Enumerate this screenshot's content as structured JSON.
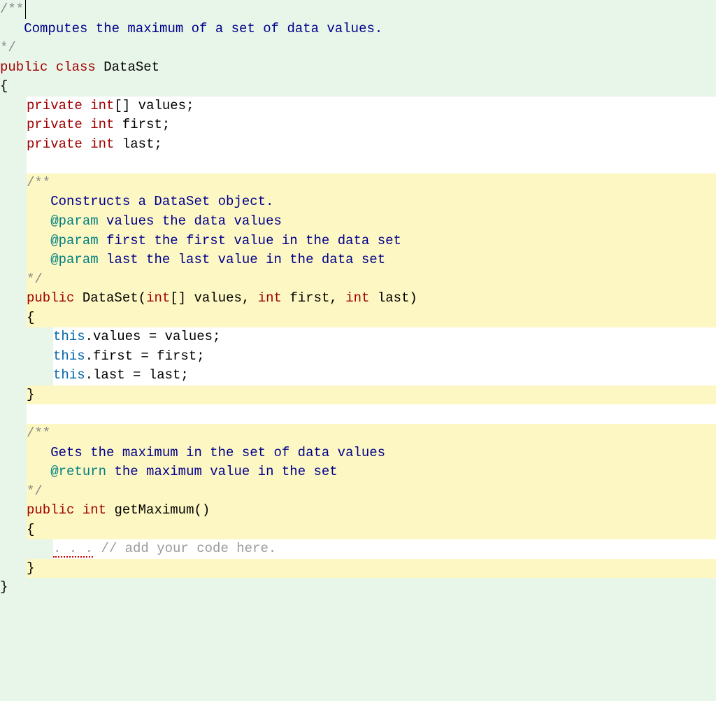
{
  "header": {
    "comment_open": "/**",
    "comment_text": "   Computes the maximum of a set of data values.",
    "comment_close": "*/",
    "public": "public",
    "class": "class",
    "classname": "DataSet",
    "brace_open": "{",
    "brace_close": "}"
  },
  "fields": {
    "private": "private",
    "int": "int",
    "values": "values",
    "first": "first",
    "last": "last",
    "brackets": "[]",
    "semi": ";"
  },
  "ctor": {
    "comment_open": "/**",
    "line1": "   Constructs a DataSet object.",
    "param": "@param",
    "p1": " values the data values",
    "p2": " first the first value in the data set",
    "p3": " last the last value in the data set",
    "comment_close": "*/",
    "public": "public",
    "name": "DataSet",
    "int": "int",
    "values": "values",
    "first": "first",
    "last": "last",
    "brackets": "[]",
    "brace_open": "{",
    "brace_close": "}",
    "this": "this",
    "body1a": ".values = values;",
    "body2a": ".first = first;",
    "body3a": ".last = last;"
  },
  "getmax": {
    "comment_open": "/**",
    "line1": "   Gets the maximum in the set of data values",
    "return": "@return",
    "r1": " the maximum value in the set",
    "comment_close": "*/",
    "public": "public",
    "int": "int",
    "name": "getMaximum",
    "parens": "()",
    "brace_open": "{",
    "brace_close": "}",
    "placeholder_dots": ". . .",
    "placeholder_comment": " // add your code here."
  }
}
